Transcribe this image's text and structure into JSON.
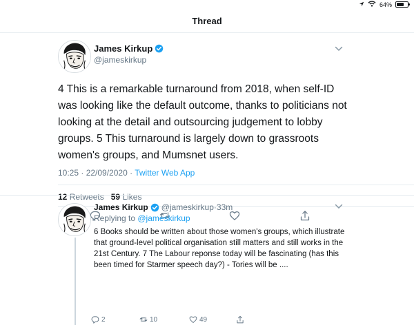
{
  "status_bar": {
    "battery": "64%",
    "battery_level": 0.64
  },
  "nav": {
    "title": "Thread"
  },
  "main_tweet": {
    "author_name": "James Kirkup",
    "author_handle": "@jameskirkup",
    "text": "4 This is a remarkable turnaround from 2018, when self-ID was looking like the default outcome, thanks to politicians not looking at the detail and outsourcing judgement to lobby groups.   5 This turnaround is largely down to grassroots women's groups, and Mumsnet users.",
    "timestamp": "10:25 · 22/09/2020 · ",
    "source": "Twitter Web App",
    "retweets_count": "12",
    "retweets_label": "Retweets",
    "likes_count": "59",
    "likes_label": "Likes"
  },
  "reply_tweet": {
    "author_name": "James Kirkup",
    "handle_time": "@jameskirkup·33m",
    "replying_prefix": "Replying to ",
    "replying_to": "@jameskirkup",
    "text": "6 Books should be written about those women's groups, which illustrate that ground-level political organisation still matters and still works in the 21st Century.   7 The Labour reponse today will be fascinating (has this been timed for Starmer speech day?) - Tories will be ....",
    "reply_count": "2",
    "retweet_count": "10",
    "like_count": "49"
  },
  "colors": {
    "accent": "#1da1f2",
    "secondary_text": "#657786",
    "divider": "#e6ecf0"
  },
  "icons": [
    "wifi-icon",
    "location-icon",
    "battery-icon",
    "verified-icon",
    "chevron-down-icon",
    "reply-icon",
    "retweet-icon",
    "like-icon",
    "share-icon"
  ]
}
